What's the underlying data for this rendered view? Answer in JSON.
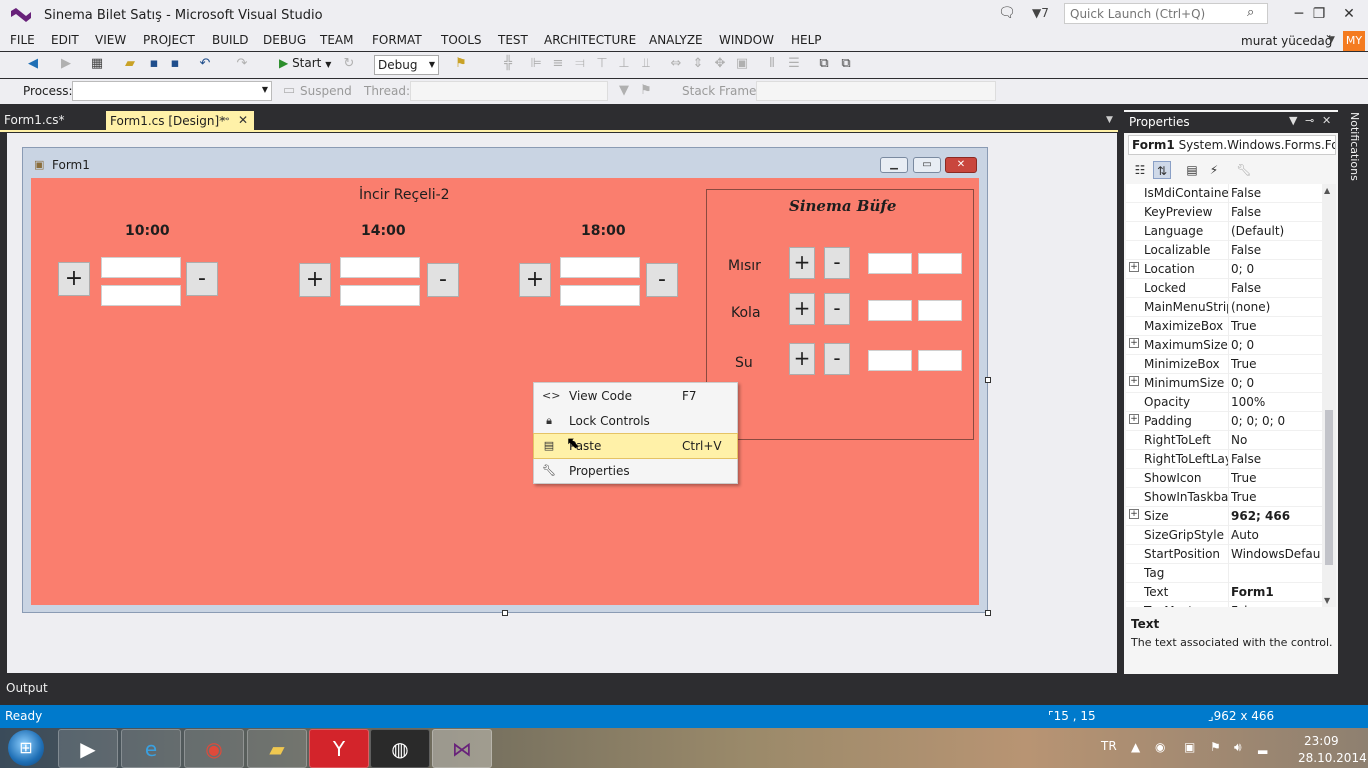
{
  "window": {
    "title": "Sinema Bilet Satış - Microsoft Visual Studio",
    "quick_launch_placeholder": "Quick Launch (Ctrl+Q)",
    "filter_count": "7",
    "user": "murat yücedağ",
    "avatar": "MY"
  },
  "menu": [
    "FILE",
    "EDIT",
    "VIEW",
    "PROJECT",
    "BUILD",
    "DEBUG",
    "TEAM",
    "FORMAT",
    "TOOLS",
    "TEST",
    "ARCHITECTURE",
    "ANALYZE",
    "WINDOW",
    "HELP"
  ],
  "toolbar": {
    "start_label": "Start",
    "config": "Debug",
    "process_label": "Process:",
    "suspend_label": "Suspend",
    "thread_label": "Thread:",
    "stack_frame_label": "Stack Frame:"
  },
  "tabs": [
    {
      "label": "Form1.cs*"
    },
    {
      "label": "Form1.cs [Design]*"
    }
  ],
  "form": {
    "title": "Form1",
    "movie_title": "İncir Reçeli-2",
    "times": [
      "10:00",
      "14:00",
      "18:00"
    ],
    "plus": "+",
    "minus": "-",
    "buffet": {
      "title": "Sinema Büfe",
      "items": [
        "Mısır",
        "Kola",
        "Su"
      ]
    }
  },
  "context_menu": [
    {
      "icon": "code-icon",
      "label": "View Code",
      "shortcut": "F7"
    },
    {
      "icon": "lock-icon",
      "label": "Lock Controls",
      "shortcut": ""
    },
    {
      "icon": "paste-icon",
      "label": "Paste",
      "shortcut": "Ctrl+V"
    },
    {
      "icon": "wrench-icon",
      "label": "Properties",
      "shortcut": ""
    }
  ],
  "properties": {
    "header": "Properties",
    "object_name": "Form1",
    "object_type": "System.Windows.Forms.Form",
    "rows": [
      {
        "name": "IsMdiContainer",
        "value": "False",
        "expandable": false,
        "bold": false
      },
      {
        "name": "KeyPreview",
        "value": "False",
        "expandable": false,
        "bold": false
      },
      {
        "name": "Language",
        "value": "(Default)",
        "expandable": false,
        "bold": false
      },
      {
        "name": "Localizable",
        "value": "False",
        "expandable": false,
        "bold": false
      },
      {
        "name": "Location",
        "value": "0; 0",
        "expandable": true,
        "bold": false
      },
      {
        "name": "Locked",
        "value": "False",
        "expandable": false,
        "bold": false
      },
      {
        "name": "MainMenuStrip",
        "value": "(none)",
        "expandable": false,
        "bold": false
      },
      {
        "name": "MaximizeBox",
        "value": "True",
        "expandable": false,
        "bold": false
      },
      {
        "name": "MaximumSize",
        "value": "0; 0",
        "expandable": true,
        "bold": false
      },
      {
        "name": "MinimizeBox",
        "value": "True",
        "expandable": false,
        "bold": false
      },
      {
        "name": "MinimumSize",
        "value": "0; 0",
        "expandable": true,
        "bold": false
      },
      {
        "name": "Opacity",
        "value": "100%",
        "expandable": false,
        "bold": false
      },
      {
        "name": "Padding",
        "value": "0; 0; 0; 0",
        "expandable": true,
        "bold": false
      },
      {
        "name": "RightToLeft",
        "value": "No",
        "expandable": false,
        "bold": false
      },
      {
        "name": "RightToLeftLayout",
        "value": "False",
        "expandable": false,
        "bold": false
      },
      {
        "name": "ShowIcon",
        "value": "True",
        "expandable": false,
        "bold": false
      },
      {
        "name": "ShowInTaskbar",
        "value": "True",
        "expandable": false,
        "bold": false
      },
      {
        "name": "Size",
        "value": "962; 466",
        "expandable": true,
        "bold": true
      },
      {
        "name": "SizeGripStyle",
        "value": "Auto",
        "expandable": false,
        "bold": false
      },
      {
        "name": "StartPosition",
        "value": "WindowsDefault",
        "expandable": false,
        "bold": false
      },
      {
        "name": "Tag",
        "value": "",
        "expandable": false,
        "bold": false
      },
      {
        "name": "Text",
        "value": "Form1",
        "expandable": false,
        "bold": true
      },
      {
        "name": "TopMost",
        "value": "False",
        "expandable": false,
        "bold": false
      }
    ],
    "desc_title": "Text",
    "desc_text": "The text associated with the control."
  },
  "notifications_label": "Notifications",
  "output_label": "Output",
  "status": {
    "ready": "Ready",
    "position": "15 , 15",
    "size": "962 x 466"
  },
  "taskbar": {
    "lang": "TR",
    "time": "23:09",
    "date": "28.10.2014"
  }
}
